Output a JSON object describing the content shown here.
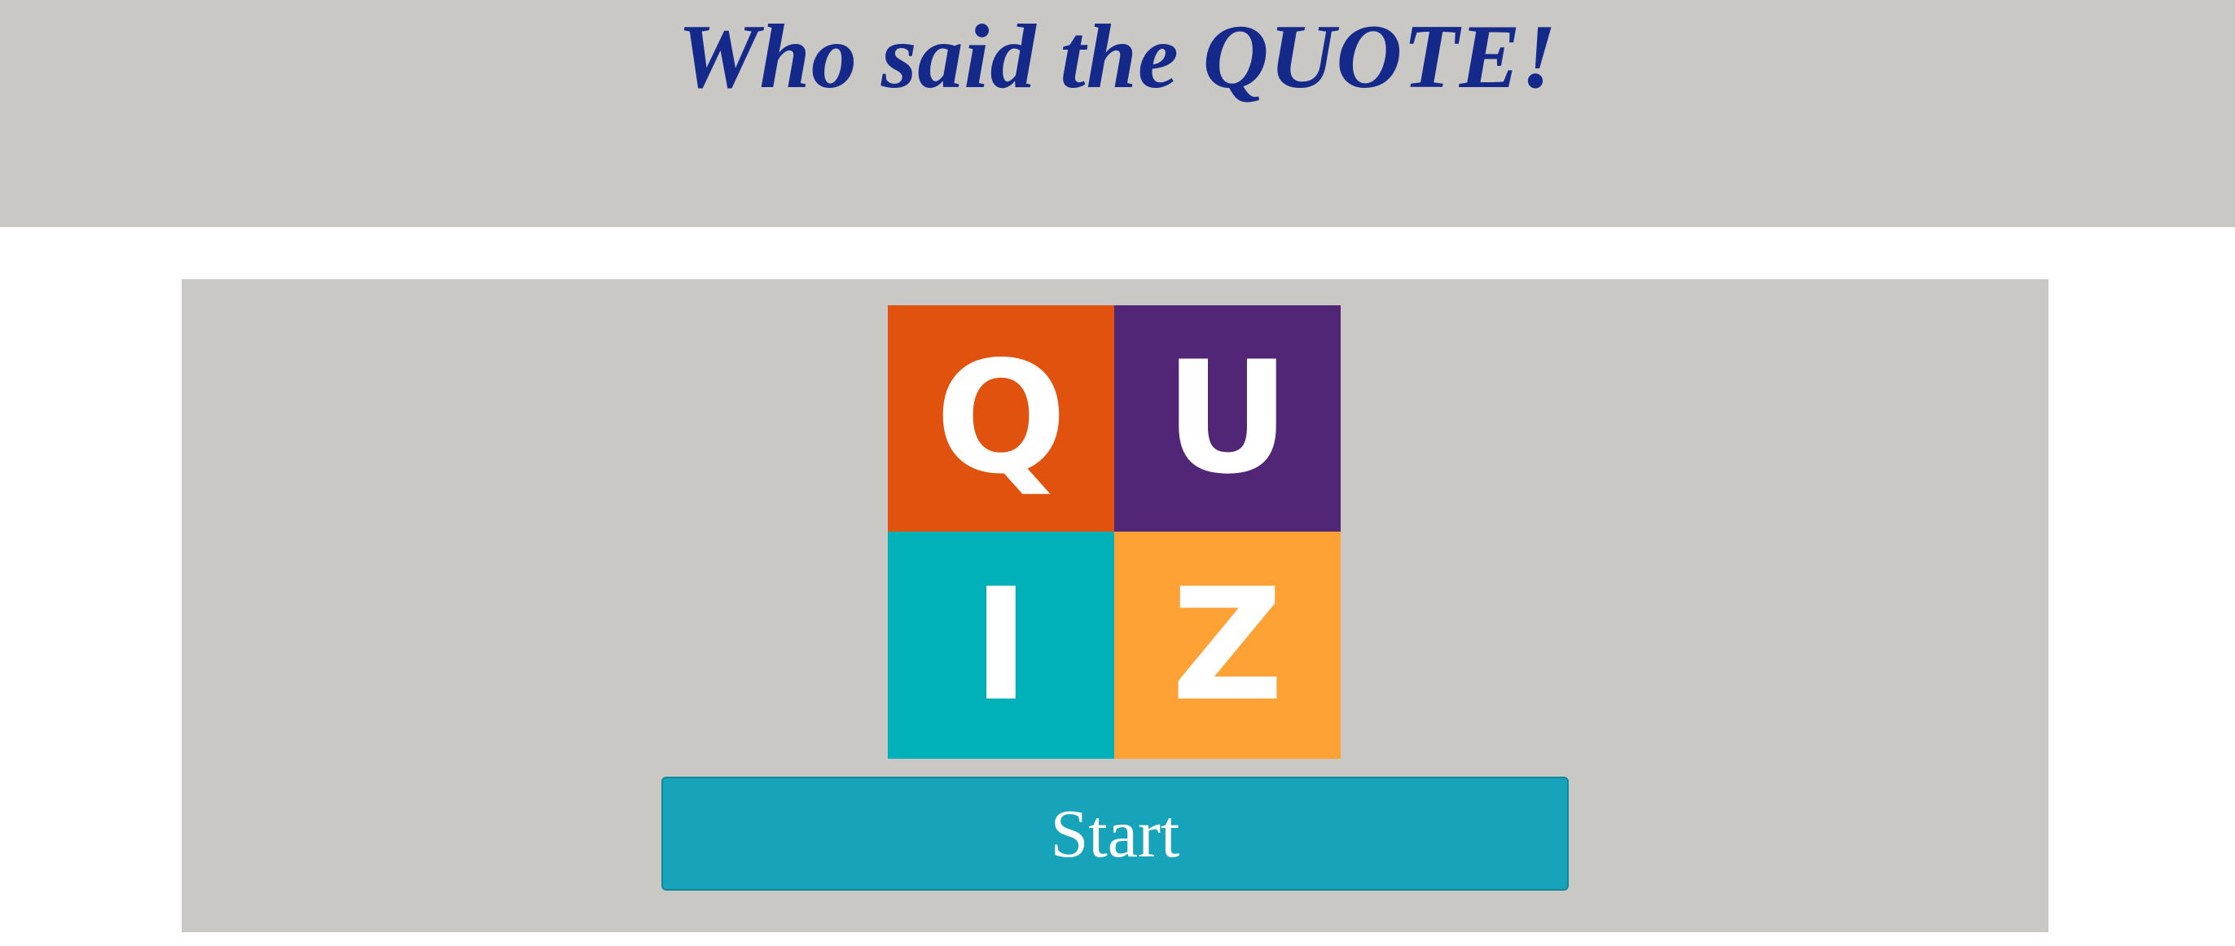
{
  "header": {
    "title": "Who said the QUOTE!"
  },
  "logo": {
    "tiles": [
      {
        "letter": "Q",
        "color": "#e1520f"
      },
      {
        "letter": "U",
        "color": "#522677"
      },
      {
        "letter": "I",
        "color": "#00b1b9"
      },
      {
        "letter": "Z",
        "color": "#ffa236"
      }
    ]
  },
  "actions": {
    "start_label": "Start"
  },
  "colors": {
    "title": "#15298a",
    "panel_background": "#c9c8c5",
    "start_button": "#17a3b9"
  }
}
